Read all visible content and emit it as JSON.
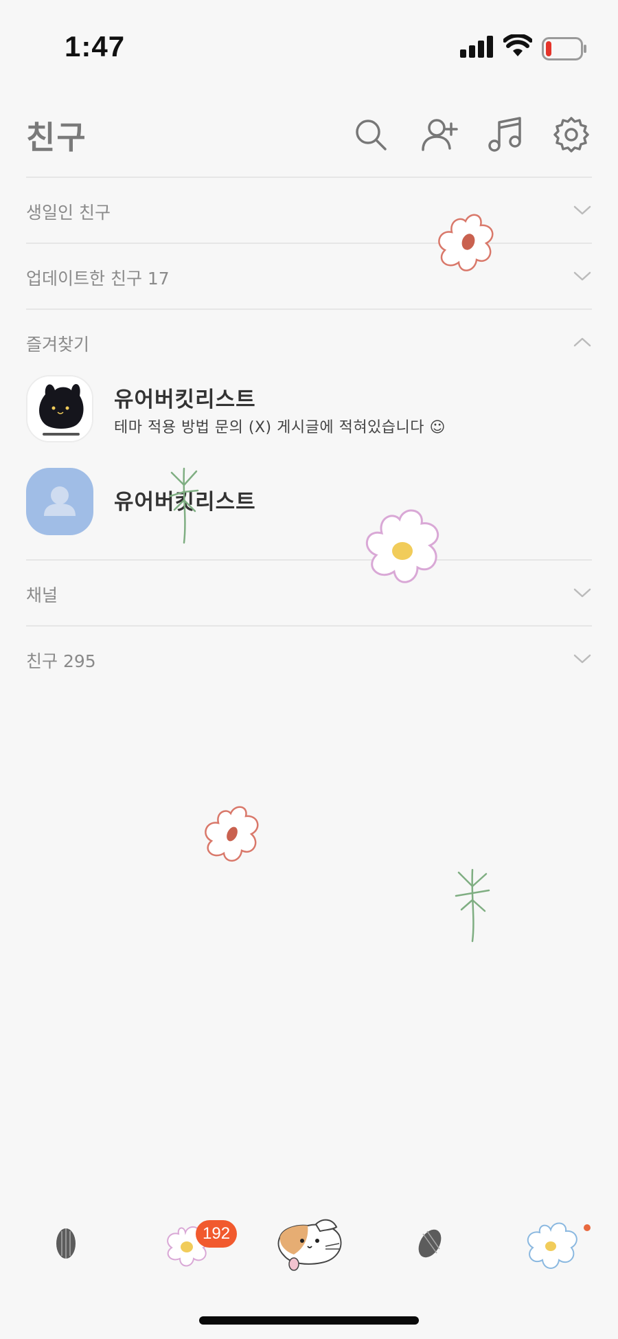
{
  "status_bar": {
    "time": "1:47"
  },
  "header": {
    "title": "친구"
  },
  "sections": {
    "birthday": "생일인 친구",
    "updated": "업데이트한 친구 17",
    "favorites": "즐겨찾기",
    "channel": "채널",
    "friends": "친구 295"
  },
  "favorites": [
    {
      "name": "유어버킷리스트",
      "status": "테마 적용 방법 문의 (X) 게시글에 적혀있습니다 ☺"
    },
    {
      "name": "유어버킷리스트",
      "status": ""
    }
  ],
  "tab_bar": {
    "chats_badge": "192"
  },
  "colors": {
    "background": "#f7f7f7",
    "badge": "#f15a2e",
    "avatar_blue": "#a0bde6",
    "flower_red": "#d9786a",
    "flower_pink": "#d9a8d6",
    "flower_yellow": "#f1cc5a",
    "stem_green": "#7fae82"
  },
  "icons": {
    "header": [
      "search-icon",
      "add-friend-icon",
      "music-icon",
      "settings-icon"
    ],
    "tabs": [
      "seed-icon",
      "flower-chat-icon",
      "puppy-icon",
      "seed-icon",
      "blue-flower-icon"
    ]
  }
}
